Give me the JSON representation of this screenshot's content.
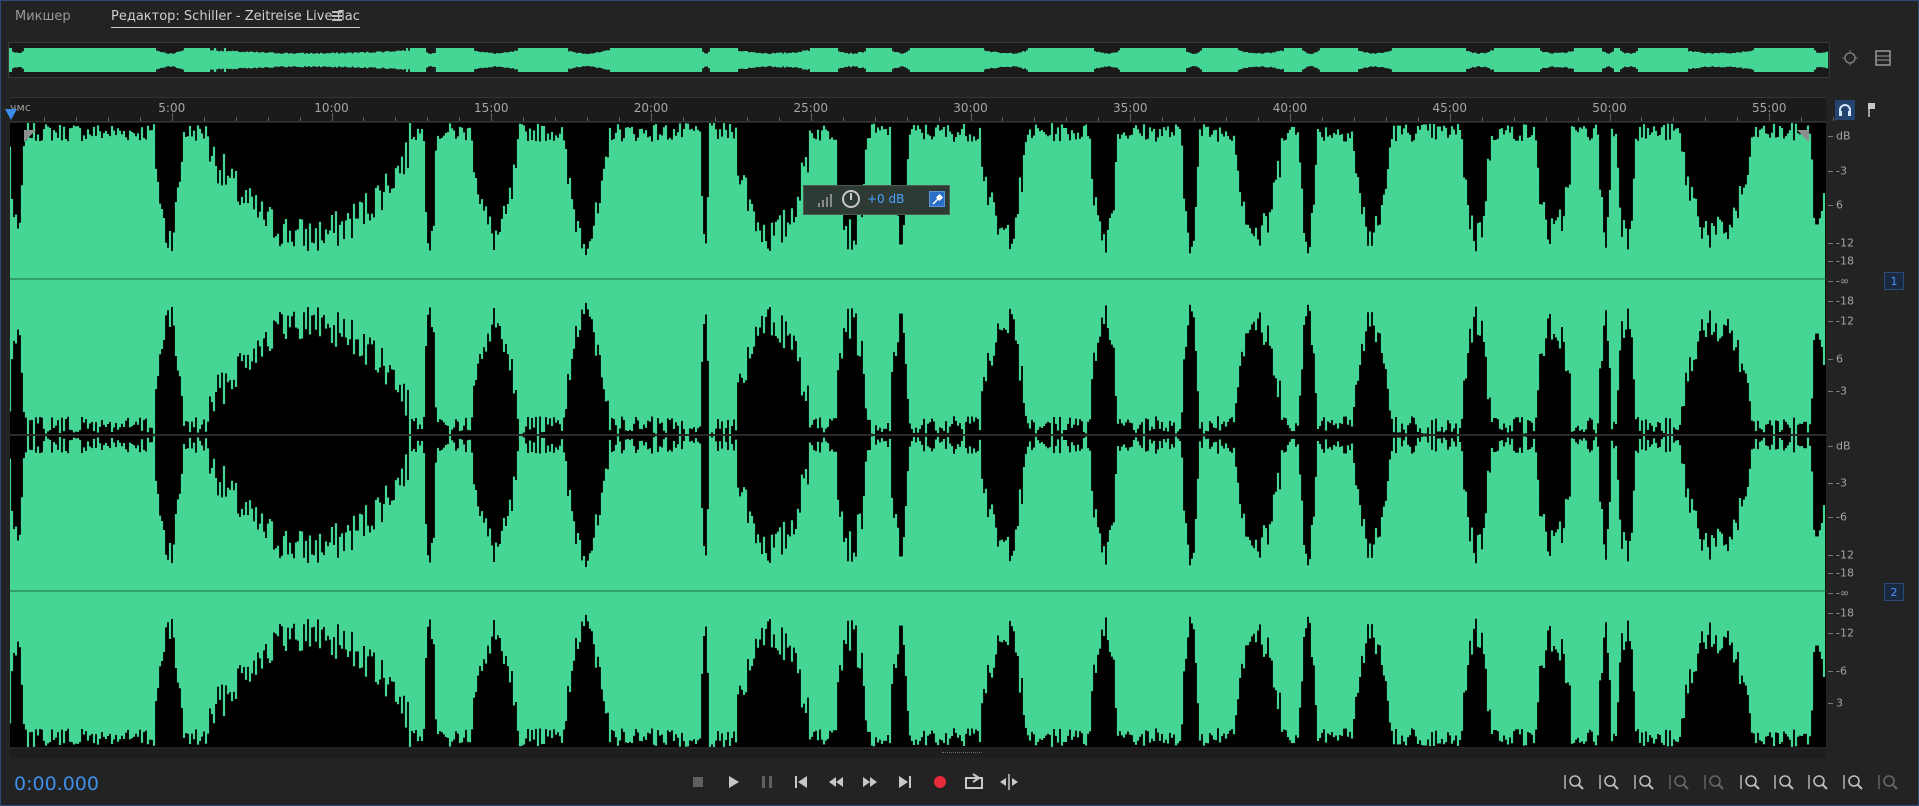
{
  "tabs": {
    "mixer_label": "Микшер",
    "editor_label": "Редактор: Schiller - Zeitreise Live.flac"
  },
  "ruler": {
    "unit_label": "чмс",
    "ticks": [
      "5:00",
      "10:00",
      "15:00",
      "20:00",
      "25:00",
      "30:00",
      "35:00",
      "40:00",
      "45:00",
      "50:00",
      "55:00"
    ]
  },
  "level_hud": {
    "value": "+0 dB"
  },
  "db_scale": {
    "unit": "dB",
    "channel1_labels": [
      "-3",
      "6",
      "-12",
      "-18",
      "-∞",
      "-18",
      "-12",
      "6",
      "-3"
    ],
    "channel2_labels": [
      "-3",
      "-6",
      "-12",
      "-18",
      "-∞",
      "-18",
      "-12",
      "-6",
      "3"
    ]
  },
  "channels": [
    "1",
    "2"
  ],
  "colors": {
    "waveform": "#45d695",
    "background": "#000000",
    "accent": "#3f8ee8",
    "record": "#e8293a"
  },
  "transport": {
    "time": "0:00.000",
    "buttons": [
      "stop-icon",
      "play-icon",
      "pause-icon",
      "go-to-start-icon",
      "rewind-icon",
      "fast-forward-icon",
      "go-to-end-icon",
      "record-icon",
      "loop-playback-icon",
      "skip-selection-icon"
    ]
  },
  "zoom": {
    "buttons": [
      "zoom-in-amplitude-icon",
      "zoom-out-amplitude-icon",
      "zoom-in-time-icon",
      "zoom-out-time-icon",
      "zoom-out-full-icon",
      "zoom-in-start-icon",
      "zoom-in-end-icon",
      "zoom-selection-icon",
      "zoom-reset-icon",
      "zoom-tracks-icon"
    ]
  }
}
